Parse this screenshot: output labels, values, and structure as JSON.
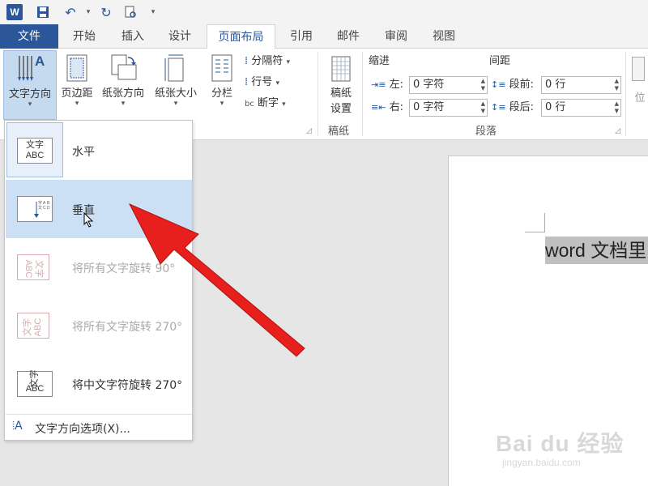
{
  "quick_access": {
    "app_icon": "W",
    "icons": [
      "save-icon",
      "undo-icon",
      "redo-icon",
      "print-preview-icon"
    ]
  },
  "tabs": [
    {
      "label": "文件"
    },
    {
      "label": "开始"
    },
    {
      "label": "插入"
    },
    {
      "label": "设计"
    },
    {
      "label": "页面布局"
    },
    {
      "label": "引用"
    },
    {
      "label": "邮件"
    },
    {
      "label": "审阅"
    },
    {
      "label": "视图"
    }
  ],
  "ribbon": {
    "text_direction": "文字方向",
    "margins": "页边距",
    "orientation": "纸张方向",
    "size": "纸张大小",
    "columns": "分栏",
    "breaks": "分隔符",
    "line_numbers": "行号",
    "hyphenation": "断字",
    "manuscript_label_1": "稿纸",
    "manuscript_label_2": "设置",
    "manuscript_group": "稿纸",
    "indent_title": "缩进",
    "spacing_title": "间距",
    "indent_left_label": "左:",
    "indent_left_value": "0 字符",
    "indent_right_label": "右:",
    "indent_right_value": "0 字符",
    "space_before_label": "段前:",
    "space_before_value": "0 行",
    "space_after_label": "段后:",
    "space_after_value": "0 行",
    "paragraph_group": "段落",
    "position_partial": "位"
  },
  "menu": {
    "items": [
      {
        "label": "水平",
        "icon_text": "文字 ABC"
      },
      {
        "label": "垂直",
        "icon_text": "1·2·3"
      },
      {
        "label": "将所有文字旋转 90°",
        "icon_text": "文字 ABC"
      },
      {
        "label": "将所有文字旋转 270°",
        "icon_text": "文字 ABC"
      },
      {
        "label": "将中文字符旋转 270°",
        "icon_text": "文字 ABC"
      }
    ],
    "selected_index": 1,
    "footer": "文字方向选项(X)..."
  },
  "document": {
    "text": "word 文档里"
  },
  "watermark": {
    "main": "Bai du 经验",
    "sub": "jingyan.baidu.com"
  }
}
